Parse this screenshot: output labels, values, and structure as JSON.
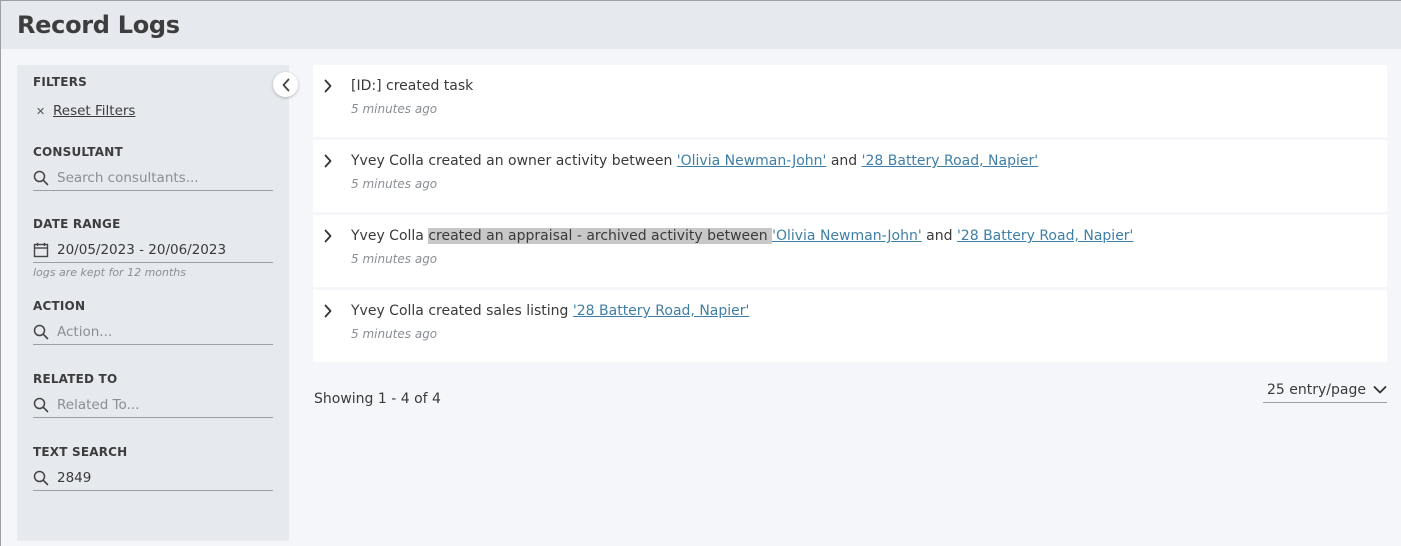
{
  "page": {
    "title": "Record Logs"
  },
  "sidebar": {
    "filters_label": "FILTERS",
    "reset_label": "Reset Filters",
    "consultant": {
      "label": "CONSULTANT",
      "placeholder": "Search consultants...",
      "icon": "search-icon"
    },
    "date_range": {
      "label": "DATE RANGE",
      "value": "20/05/2023 - 20/06/2023",
      "hint": "logs are kept for 12 months",
      "icon": "calendar-icon"
    },
    "action": {
      "label": "ACTION",
      "placeholder": "Action...",
      "icon": "search-icon"
    },
    "related_to": {
      "label": "RELATED TO",
      "placeholder": "Related To...",
      "icon": "search-icon"
    },
    "text_search": {
      "label": "TEXT SEARCH",
      "value": "2849",
      "icon": "search-icon"
    }
  },
  "logs": [
    {
      "text": "[ID:] created task",
      "time": "5 minutes ago"
    },
    {
      "prefix": "Yvey Colla created an owner activity between ",
      "link1": "'Olivia Newman-John'",
      "mid": " and ",
      "link2": "'28 Battery Road, Napier'",
      "time": "5 minutes ago"
    },
    {
      "prefix": "Yvey Colla ",
      "highlight": "created an appraisal - archived activity between ",
      "link1": "'Olivia Newman-John'",
      "mid": " and ",
      "link2": "'28 Battery Road, Napier'",
      "time": "5 minutes ago"
    },
    {
      "prefix": "Yvey Colla created sales listing ",
      "link1": "'28 Battery Road, Napier'",
      "time": "5 minutes ago"
    }
  ],
  "pagination": {
    "showing": "Showing 1 - 4 of 4",
    "per_page": "25 entry/page"
  },
  "colors": {
    "link": "#3f7fa6",
    "panel": "#e6e9ed",
    "background": "#f4f6f9",
    "highlight": "#c8c8c8"
  }
}
